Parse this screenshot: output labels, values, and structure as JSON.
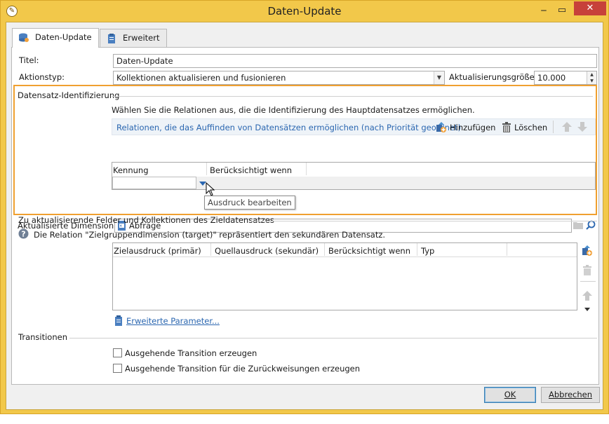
{
  "window": {
    "title": "Daten-Update",
    "min_glyph": "‒",
    "max_glyph": "▭",
    "close_glyph": "✕"
  },
  "tabs": [
    {
      "label": "Daten-Update"
    },
    {
      "label": "Erweitert"
    }
  ],
  "form": {
    "title_label": "Titel:",
    "title_value": "Daten-Update",
    "action_label": "Aktionstyp:",
    "action_value": "Kollektionen aktualisieren und fusionieren",
    "batch_label": "Aktualisierungsgröße:",
    "batch_value": "10.000"
  },
  "identification": {
    "section_title": "Datensatz-Identifizierung",
    "hint": "Wählen Sie die Relationen aus, die die Identifizierung des Hauptdatensatzes ermöglichen.",
    "toolbar_caption": "Relationen, die das Auffinden von Datensätzen ermöglichen (nach Priorität geordnet)",
    "add_label": "Hinzufügen",
    "delete_label": "Löschen",
    "columns": [
      "Kennung",
      "Berücksichtigt wenn"
    ],
    "tooltip": "Ausdruck bearbeiten",
    "dimension_label": "Aktualisierte Dimension:",
    "dimension_value": "Abfrage"
  },
  "fields_section": {
    "section_title": "Zu aktualisierende Felder und Kollektionen des Zieldatensatzes",
    "info": "Die Relation \"Zielgruppendimension (target)\" repräsentiert den sekundären Datensatz.",
    "columns": [
      "Zielausdruck (primär)",
      "Quellausdruck (sekundär)",
      "Berücksichtigt wenn",
      "Typ"
    ],
    "advanced_link": "Erweiterte Parameter..."
  },
  "transitions": {
    "section_title": "Transitionen",
    "option1": "Ausgehende Transition erzeugen",
    "option2": "Ausgehende Transition für die Zurückweisungen erzeugen"
  },
  "footer": {
    "ok_label": "OK",
    "cancel_label": "Abbrechen"
  },
  "colors": {
    "title_bar": "#f2c84a",
    "highlight_box": "#f0a030",
    "link": "#2a66b0",
    "close": "#c7413a"
  }
}
